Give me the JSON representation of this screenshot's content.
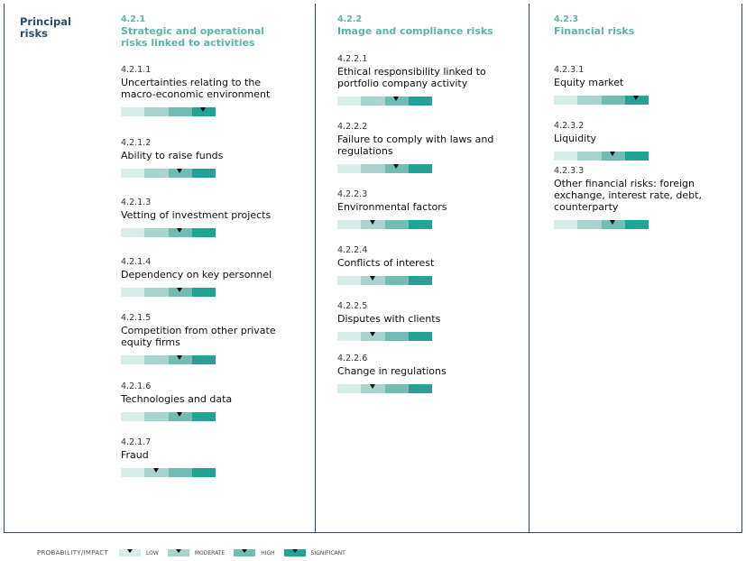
{
  "side_title": "Principal risks",
  "legend": {
    "title": "PROBABILITY/IMPACT",
    "items": [
      {
        "label": "LOW",
        "level": 0
      },
      {
        "label": "MODERATE",
        "level": 1
      },
      {
        "label": "HIGH",
        "level": 2
      },
      {
        "label": "SIGNIFICANT",
        "level": 3
      }
    ]
  },
  "colors": {
    "low": "#d8ece9",
    "moderate": "#a9d4ce",
    "high": "#6fbdb3",
    "significant": "#22a396",
    "heading": "#5bb5a8",
    "frame": "#2c4d6b"
  },
  "columns": [
    {
      "number": "4.2.1",
      "title": "Strategic and operational risks linked to activities",
      "items": [
        {
          "number": "4.2.1.1",
          "title": "Uncertainties relating to the macro-economic environment",
          "rating": 0.87
        },
        {
          "number": "4.2.1.2",
          "title": "Ability to raise funds",
          "rating": 0.62
        },
        {
          "number": "4.2.1.3",
          "title": "Vetting of investment projects",
          "rating": 0.62
        },
        {
          "number": "4.2.1.4",
          "title": "Dependency on key personnel",
          "rating": 0.62
        },
        {
          "number": "4.2.1.5",
          "title": "Competition from other private equity firms",
          "rating": 0.62
        },
        {
          "number": "4.2.1.6",
          "title": "Technologies and data",
          "rating": 0.62
        },
        {
          "number": "4.2.1.7",
          "title": "Fraud",
          "rating": 0.37
        }
      ]
    },
    {
      "number": "4.2.2",
      "title": "Image and compliance risks",
      "items": [
        {
          "number": "4.2.2.1",
          "title": "Ethical responsibility linked to portfolio company activity",
          "rating": 0.62
        },
        {
          "number": "4.2.2.2",
          "title": "Failure to comply with laws and regulations",
          "rating": 0.62
        },
        {
          "number": "4.2.2.3",
          "title": "Environmental factors",
          "rating": 0.37
        },
        {
          "number": "4.2.2.4",
          "title": "Conflicts of interest",
          "rating": 0.37
        },
        {
          "number": "4.2.2.5",
          "title": "Disputes with clients",
          "rating": 0.37
        },
        {
          "number": "4.2.2.6",
          "title": "Change in regulations",
          "rating": 0.37
        }
      ]
    },
    {
      "number": "4.2.3",
      "title": "Financial risks",
      "items": [
        {
          "number": "4.2.3.1",
          "title": "Equity market",
          "rating": 0.87
        },
        {
          "number": "4.2.3.2",
          "title": "Liquidity",
          "rating": 0.62
        },
        {
          "number": "4.2.3.3",
          "title": "Other financial risks: foreign exchange, interest rate, debt, counterparty",
          "rating": 0.62
        }
      ]
    }
  ]
}
